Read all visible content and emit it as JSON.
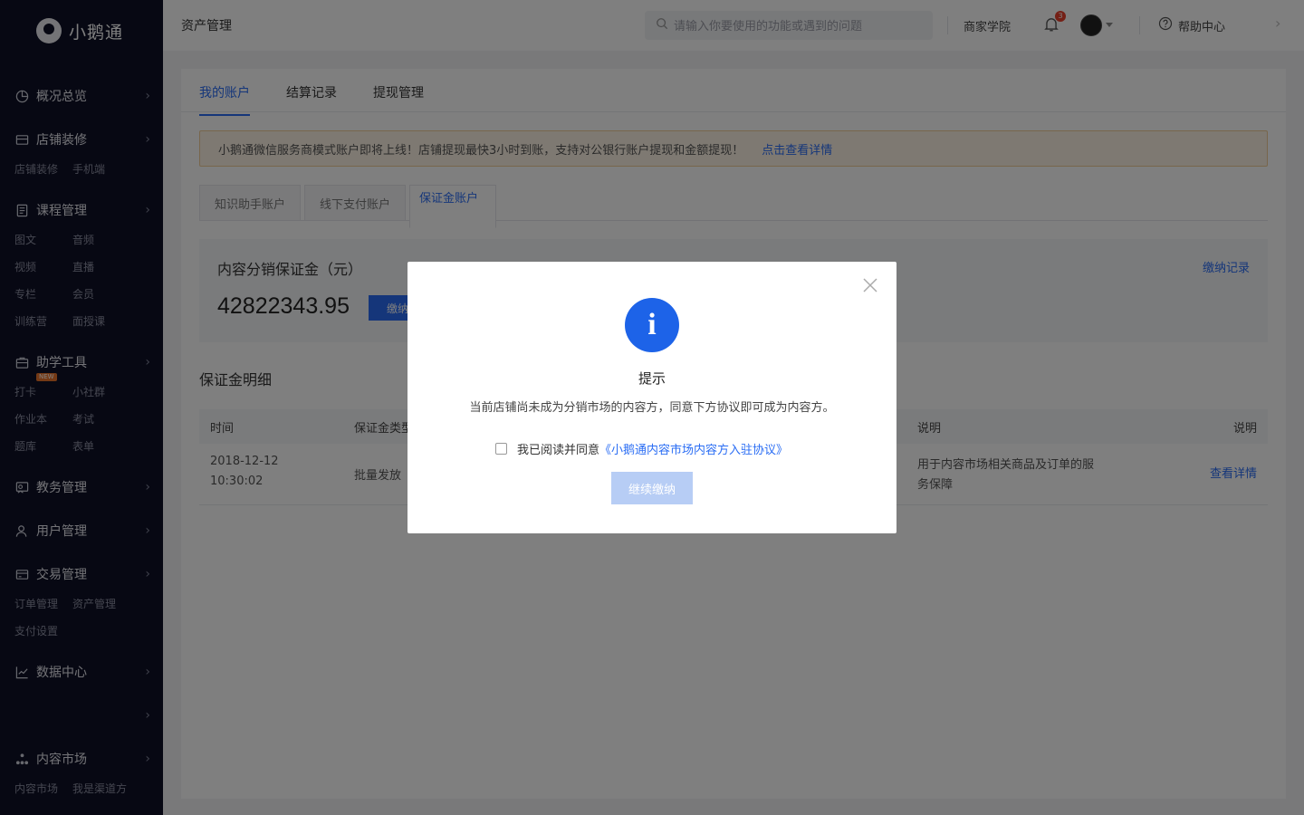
{
  "app": {
    "logo_text": "小鹅通"
  },
  "sidebar": {
    "sections": [
      {
        "title": "概况总览",
        "icon": "overview-icon",
        "items": []
      },
      {
        "title": "店铺装修",
        "icon": "store-icon",
        "items": [
          "店铺装修",
          "手机端"
        ]
      },
      {
        "title": "课程管理",
        "icon": "course-icon",
        "items": [
          "图文",
          "音频",
          "视频",
          "直播",
          "专栏",
          "会员",
          "训练营",
          "面授课"
        ]
      },
      {
        "title": "助学工具",
        "icon": "toolbox-icon",
        "items": [
          "打卡",
          "小社群",
          "作业本",
          "考试",
          "题库",
          "表单"
        ],
        "badge": "NEW"
      },
      {
        "title": "教务管理",
        "icon": "academic-icon",
        "items": []
      },
      {
        "title": "用户管理",
        "icon": "user-icon",
        "items": []
      },
      {
        "title": "交易管理",
        "icon": "trade-icon",
        "items": [
          "订单管理",
          "资产管理",
          "支付设置"
        ]
      },
      {
        "title": "数据中心",
        "icon": "chart-icon",
        "items": []
      },
      {
        "title": "",
        "icon": "",
        "items": []
      },
      {
        "title": "内容市场",
        "icon": "market-icon",
        "items": [
          "内容市场",
          "我是渠道方"
        ]
      }
    ]
  },
  "header": {
    "breadcrumb": "资产管理",
    "search_placeholder": "请输入你要使用的功能或遇到的问题",
    "academy": "商家学院",
    "notification_count": "3",
    "help": "帮助中心"
  },
  "main": {
    "tabs": [
      "我的账户",
      "结算记录",
      "提现管理"
    ],
    "active_tab": 0,
    "notice": {
      "text": "小鹅通微信服务商模式账户即将上线！店铺提现最快3小时到账，支持对公银行账户提现和金额提现！",
      "link": "点击查看详情"
    },
    "subtabs": [
      "知识助手账户",
      "线下支付账户",
      "保证金账户"
    ],
    "deposit": {
      "label": "内容分销保证金（元）",
      "amount": "42822343.95",
      "pay_button": "缴纳",
      "record_link": "缴纳记录"
    },
    "detail_title": "保证金明细",
    "table": {
      "headers": [
        "时间",
        "保证金类型",
        "说明",
        "说明"
      ],
      "rows": [
        {
          "time_date": "2018-12-12",
          "time_clock": "10:30:02",
          "type": "批量发放",
          "desc_line1": "用于内容市场相关商品及订单的服",
          "desc_line2": "务保障",
          "action": "查看详情"
        }
      ]
    }
  },
  "modal": {
    "title": "提示",
    "message": "当前店铺尚未成为分销市场的内容方，同意下方协议即可成为内容方。",
    "agree_text": "我已阅读并同意",
    "agreement_link": "《小鹅通内容市场内容方入驻协议》",
    "continue_button": "继续缴纳",
    "checkbox_checked": false
  },
  "colors": {
    "accent": "#2a6df4",
    "sidebar_bg": "#0f1126",
    "notice_bg": "#fdf3e4",
    "disabled_button": "#b7cdf5"
  }
}
